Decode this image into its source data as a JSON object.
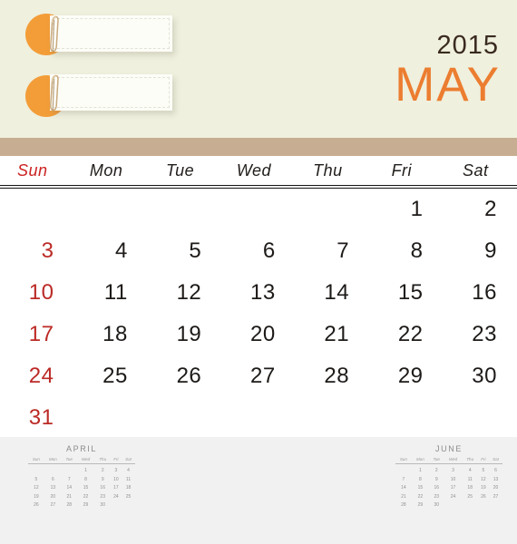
{
  "header": {
    "year": "2015",
    "month": "MAY",
    "accent_color": "#ec7d30",
    "year_color": "#3a2a20",
    "background_color": "#eff0de",
    "bar_color": "#c7ae92",
    "stickers": [
      {
        "label": "",
        "dot_color": "#f39d38",
        "clip": "paperclip-icon"
      },
      {
        "label": "",
        "dot_color": "#f39d38",
        "clip": "paperclip-icon"
      }
    ]
  },
  "calendar": {
    "weekday_headers": [
      "Sun",
      "Mon",
      "Tue",
      "Wed",
      "Thu",
      "Fri",
      "Sat"
    ],
    "sunday_color": "#bb2a26",
    "weekday_color": "#1d1a18",
    "weeks": [
      [
        "",
        "",
        "",
        "",
        "",
        "1",
        "2"
      ],
      [
        "3",
        "4",
        "5",
        "6",
        "7",
        "8",
        "9"
      ],
      [
        "10",
        "11",
        "12",
        "13",
        "14",
        "15",
        "16"
      ],
      [
        "17",
        "18",
        "19",
        "20",
        "21",
        "22",
        "23"
      ],
      [
        "24",
        "25",
        "26",
        "27",
        "28",
        "29",
        "30"
      ],
      [
        "31",
        "",
        "",
        "",
        "",
        "",
        ""
      ]
    ]
  },
  "footer": {
    "background_color": "#f1f1f1",
    "mini_weekday_headers": [
      "Sun",
      "Mon",
      "Tue",
      "Wed",
      "Thu",
      "Fri",
      "Sat"
    ],
    "prev_month": {
      "title": "APRIL",
      "weeks": [
        [
          "",
          "",
          "",
          "1",
          "2",
          "3",
          "4"
        ],
        [
          "5",
          "6",
          "7",
          "8",
          "9",
          "10",
          "11"
        ],
        [
          "12",
          "13",
          "14",
          "15",
          "16",
          "17",
          "18"
        ],
        [
          "19",
          "20",
          "21",
          "22",
          "23",
          "24",
          "25"
        ],
        [
          "26",
          "27",
          "28",
          "29",
          "30",
          "",
          ""
        ]
      ]
    },
    "next_month": {
      "title": "JUNE",
      "weeks": [
        [
          "",
          "1",
          "2",
          "3",
          "4",
          "5",
          "6"
        ],
        [
          "7",
          "8",
          "9",
          "10",
          "11",
          "12",
          "13"
        ],
        [
          "14",
          "15",
          "16",
          "17",
          "18",
          "19",
          "20"
        ],
        [
          "21",
          "22",
          "23",
          "24",
          "25",
          "26",
          "27"
        ],
        [
          "28",
          "29",
          "30",
          "",
          "",
          "",
          ""
        ]
      ]
    }
  }
}
